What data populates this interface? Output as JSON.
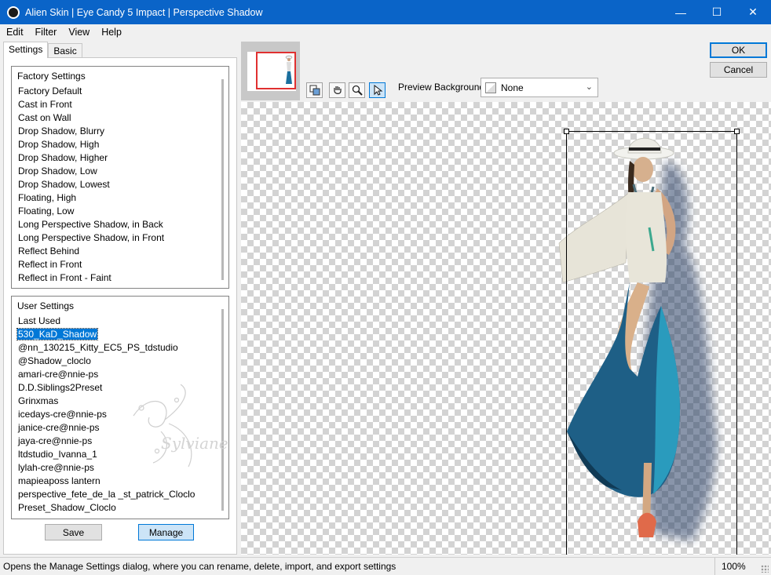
{
  "window": {
    "title": "Alien Skin | Eye Candy 5 Impact | Perspective Shadow",
    "minimize": "—",
    "maximize": "☐",
    "close": "✕"
  },
  "menu": [
    "Edit",
    "Filter",
    "View",
    "Help"
  ],
  "tabs": [
    {
      "label": "Settings",
      "active": true
    },
    {
      "label": "Basic",
      "active": false
    }
  ],
  "factory_settings": {
    "header": "Factory Settings",
    "items": [
      "Factory Default",
      "Cast in Front",
      "Cast on Wall",
      "Drop Shadow, Blurry",
      "Drop Shadow, High",
      "Drop Shadow, Higher",
      "Drop Shadow, Low",
      "Drop Shadow, Lowest",
      "Floating, High",
      "Floating, Low",
      "Long Perspective Shadow, in Back",
      "Long Perspective Shadow, in Front",
      "Reflect Behind",
      "Reflect in Front",
      "Reflect in Front - Faint"
    ]
  },
  "user_settings": {
    "header": "User Settings",
    "selected": "530_KaD_Shadow",
    "items": [
      "Last Used",
      "530_KaD_Shadow",
      "@nn_130215_Kitty_EC5_PS_tdstudio",
      "@Shadow_cloclo",
      "amari-cre@nnie-ps",
      "D.D.Siblings2Preset",
      "Grinxmas",
      "icedays-cre@nnie-ps",
      "janice-cre@nnie-ps",
      "jaya-cre@nnie-ps",
      "ltdstudio_Ivanna_1",
      "lylah-cre@nnie-ps",
      "mapieaposs lantern",
      "perspective_fete_de_la _st_patrick_Cloclo",
      "Preset_Shadow_Cloclo"
    ]
  },
  "buttons": {
    "save": "Save",
    "manage": "Manage",
    "ok": "OK",
    "cancel": "Cancel"
  },
  "preview": {
    "background_label": "Preview Background:",
    "background_value": "None"
  },
  "status": {
    "message": "Opens the Manage Settings dialog, where you can rename, delete, import, and export settings",
    "zoom": "100%"
  },
  "watermark": "Sylviane",
  "colors": {
    "titlebar": "#0a64c8",
    "selection": "#0078d7",
    "thumb_frame": "#e03030"
  }
}
